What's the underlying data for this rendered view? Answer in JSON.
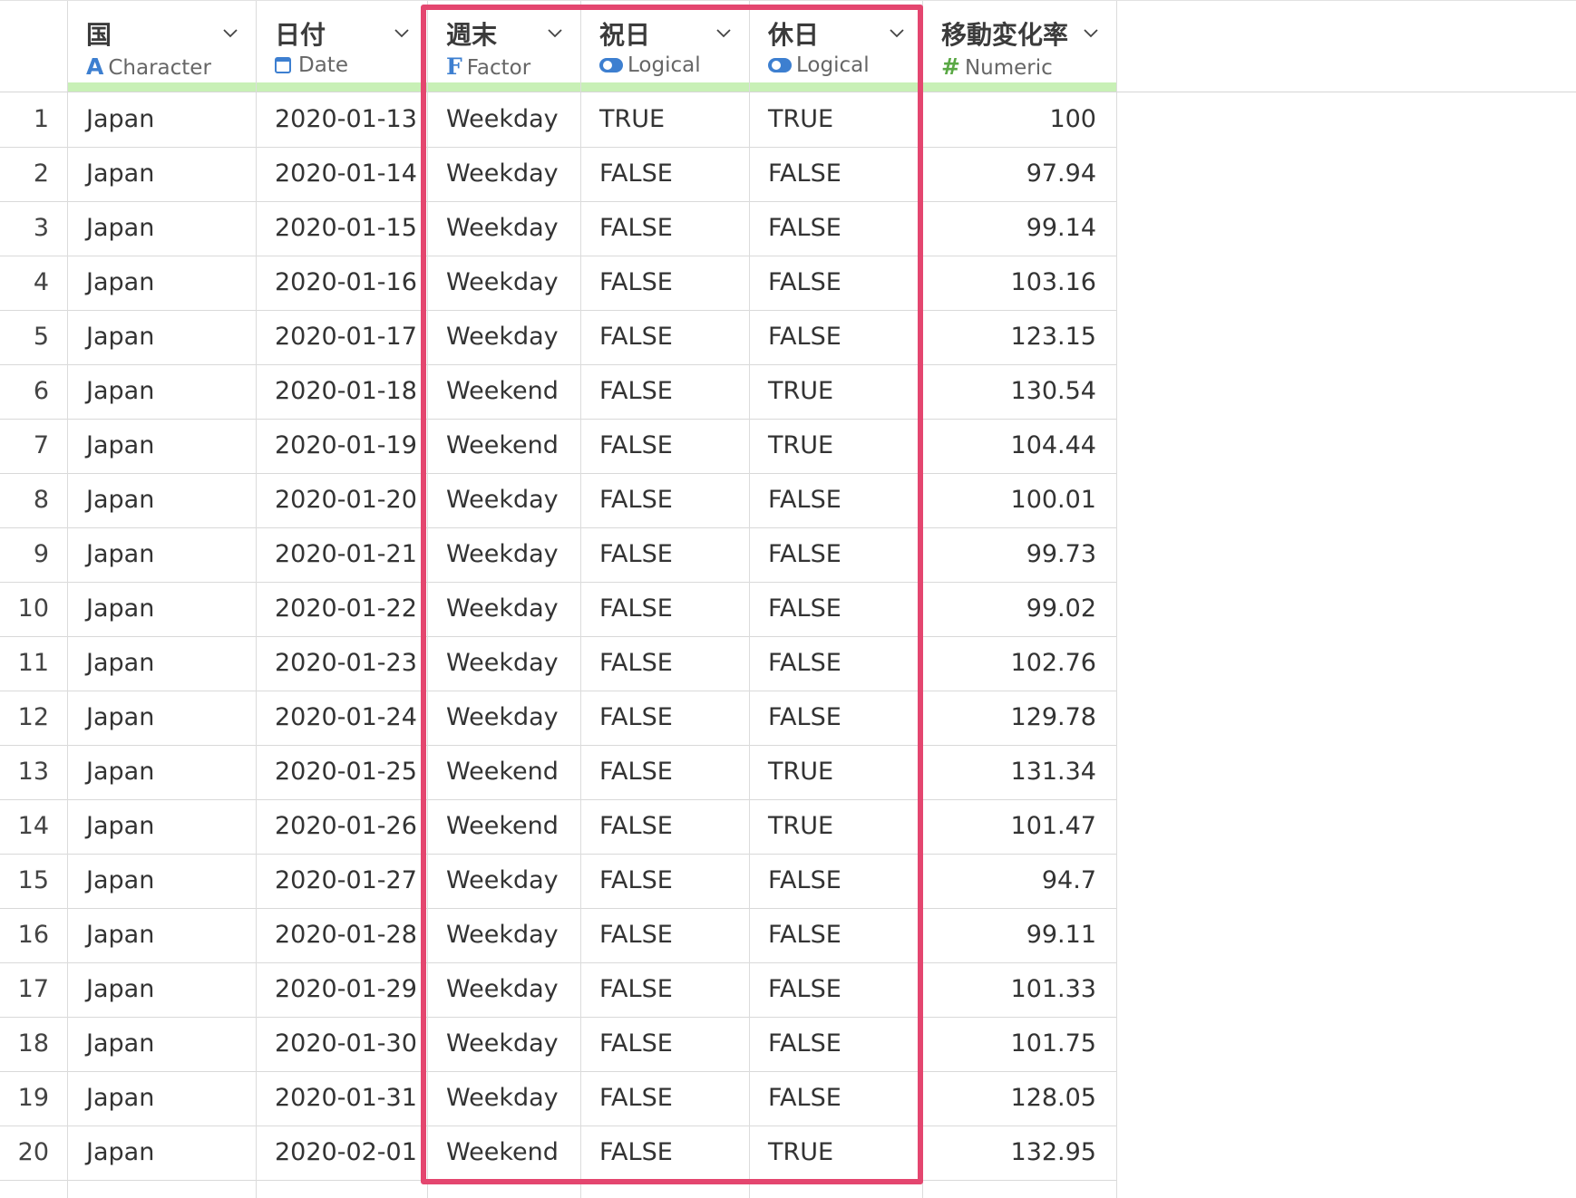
{
  "columns": [
    {
      "name": "国",
      "type": "Character",
      "icon": "A",
      "icon_name": "character-type-icon",
      "icon_color": "#3d7fd0"
    },
    {
      "name": "日付",
      "type": "Date",
      "icon": "",
      "icon_name": "calendar-icon",
      "icon_color": "#3d7fd0"
    },
    {
      "name": "週末",
      "type": "Factor",
      "icon": "F",
      "icon_name": "factor-type-icon",
      "icon_color": "#3d7fd0"
    },
    {
      "name": "祝日",
      "type": "Logical",
      "icon": "",
      "icon_name": "logical-toggle-icon",
      "icon_color": "#3d7fd0"
    },
    {
      "name": "休日",
      "type": "Logical",
      "icon": "",
      "icon_name": "logical-toggle-icon",
      "icon_color": "#3d7fd0"
    },
    {
      "name": "移動変化率",
      "type": "Numeric",
      "icon": "#",
      "icon_name": "numeric-type-icon",
      "icon_color": "#5aa845"
    }
  ],
  "rows": [
    [
      "1",
      "Japan",
      "2020-01-13",
      "Weekday",
      "TRUE",
      "TRUE",
      "100"
    ],
    [
      "2",
      "Japan",
      "2020-01-14",
      "Weekday",
      "FALSE",
      "FALSE",
      "97.94"
    ],
    [
      "3",
      "Japan",
      "2020-01-15",
      "Weekday",
      "FALSE",
      "FALSE",
      "99.14"
    ],
    [
      "4",
      "Japan",
      "2020-01-16",
      "Weekday",
      "FALSE",
      "FALSE",
      "103.16"
    ],
    [
      "5",
      "Japan",
      "2020-01-17",
      "Weekday",
      "FALSE",
      "FALSE",
      "123.15"
    ],
    [
      "6",
      "Japan",
      "2020-01-18",
      "Weekend",
      "FALSE",
      "TRUE",
      "130.54"
    ],
    [
      "7",
      "Japan",
      "2020-01-19",
      "Weekend",
      "FALSE",
      "TRUE",
      "104.44"
    ],
    [
      "8",
      "Japan",
      "2020-01-20",
      "Weekday",
      "FALSE",
      "FALSE",
      "100.01"
    ],
    [
      "9",
      "Japan",
      "2020-01-21",
      "Weekday",
      "FALSE",
      "FALSE",
      "99.73"
    ],
    [
      "10",
      "Japan",
      "2020-01-22",
      "Weekday",
      "FALSE",
      "FALSE",
      "99.02"
    ],
    [
      "11",
      "Japan",
      "2020-01-23",
      "Weekday",
      "FALSE",
      "FALSE",
      "102.76"
    ],
    [
      "12",
      "Japan",
      "2020-01-24",
      "Weekday",
      "FALSE",
      "FALSE",
      "129.78"
    ],
    [
      "13",
      "Japan",
      "2020-01-25",
      "Weekend",
      "FALSE",
      "TRUE",
      "131.34"
    ],
    [
      "14",
      "Japan",
      "2020-01-26",
      "Weekend",
      "FALSE",
      "TRUE",
      "101.47"
    ],
    [
      "15",
      "Japan",
      "2020-01-27",
      "Weekday",
      "FALSE",
      "FALSE",
      "94.7"
    ],
    [
      "16",
      "Japan",
      "2020-01-28",
      "Weekday",
      "FALSE",
      "FALSE",
      "99.11"
    ],
    [
      "17",
      "Japan",
      "2020-01-29",
      "Weekday",
      "FALSE",
      "FALSE",
      "101.33"
    ],
    [
      "18",
      "Japan",
      "2020-01-30",
      "Weekday",
      "FALSE",
      "FALSE",
      "101.75"
    ],
    [
      "19",
      "Japan",
      "2020-01-31",
      "Weekday",
      "FALSE",
      "FALSE",
      "128.05"
    ],
    [
      "20",
      "Japan",
      "2020-02-01",
      "Weekend",
      "FALSE",
      "TRUE",
      "132.95"
    ]
  ],
  "colors": {
    "highlight_border": "#e4466f",
    "type_bar": "#c8f0b6",
    "accent_blue": "#3d7fd0",
    "numeric_green": "#5aa845"
  }
}
